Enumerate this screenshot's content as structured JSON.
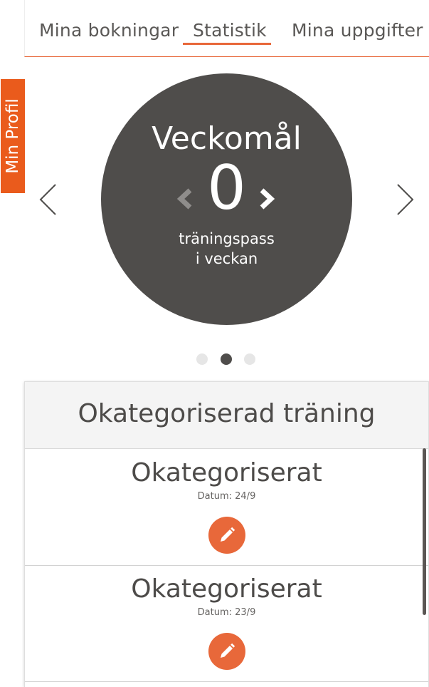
{
  "tabs": [
    {
      "label": "Mina bokningar",
      "active": false
    },
    {
      "label": "Statistik",
      "active": true
    },
    {
      "label": "Mina uppgifter",
      "active": false
    }
  ],
  "profile_tab": {
    "label": "Min Profil"
  },
  "carousel": {
    "title": "Veckomål",
    "value": "0",
    "unit_line1": "träningspass",
    "unit_line2": "i veckan",
    "pages": 3,
    "active_page": 2
  },
  "category": {
    "title": "Okategoriserad träning",
    "items": [
      {
        "title": "Okategoriserat",
        "date": "Datum: 24/9"
      },
      {
        "title": "Okategoriserat",
        "date": "Datum: 23/9"
      }
    ]
  },
  "colors": {
    "accent": "#e8683a",
    "profile_tab": "#ea5b1c",
    "circle": "#4f4d4b",
    "text": "#4d4b49"
  },
  "icons": {
    "prev": "chevron-left-icon",
    "next": "chevron-right-icon",
    "decrease": "caret-left-icon",
    "increase": "caret-right-icon",
    "edit": "pencil-icon"
  }
}
